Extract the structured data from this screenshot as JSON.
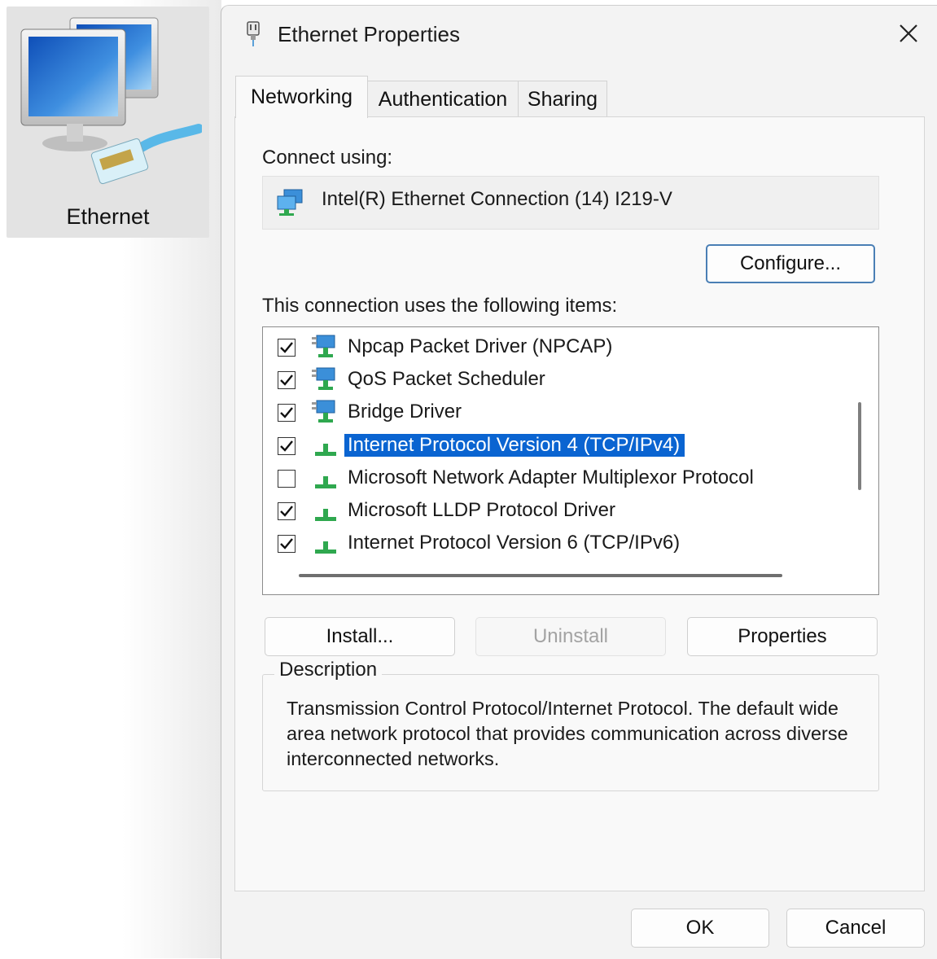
{
  "desktop": {
    "icon_label": "Ethernet"
  },
  "dialog": {
    "title": "Ethernet Properties",
    "close_symbol": "✕",
    "tabs": [
      {
        "label": "Networking",
        "active": true
      },
      {
        "label": "Authentication",
        "active": false
      },
      {
        "label": "Sharing",
        "active": false
      }
    ],
    "networking": {
      "connect_using_label": "Connect using:",
      "adapter_name": "Intel(R) Ethernet Connection (14) I219-V",
      "configure_button": "Configure...",
      "items_label": "This connection uses the following items:",
      "items": [
        {
          "label": "Npcap Packet Driver (NPCAP)",
          "checked": true,
          "icon": "network-service-icon",
          "selected": false
        },
        {
          "label": "QoS Packet Scheduler",
          "checked": true,
          "icon": "network-service-icon",
          "selected": false
        },
        {
          "label": "Bridge Driver",
          "checked": true,
          "icon": "network-service-icon",
          "selected": false
        },
        {
          "label": "Internet Protocol Version 4 (TCP/IPv4)",
          "checked": true,
          "icon": "protocol-icon",
          "selected": true
        },
        {
          "label": "Microsoft Network Adapter Multiplexor Protocol",
          "checked": false,
          "icon": "protocol-icon",
          "selected": false
        },
        {
          "label": "Microsoft LLDP Protocol Driver",
          "checked": true,
          "icon": "protocol-icon",
          "selected": false
        },
        {
          "label": "Internet Protocol Version 6 (TCP/IPv6)",
          "checked": true,
          "icon": "protocol-icon",
          "selected": false
        }
      ],
      "install_button": "Install...",
      "uninstall_button": "Uninstall",
      "properties_button": "Properties",
      "description_legend": "Description",
      "description_text": "Transmission Control Protocol/Internet Protocol. The default wide area network protocol that provides communication across diverse interconnected networks."
    },
    "ok_button": "OK",
    "cancel_button": "Cancel"
  },
  "colors": {
    "selection": "#0a64d1",
    "dialog_bg": "#f3f3f3",
    "panel_bg": "#f9f9f9"
  }
}
